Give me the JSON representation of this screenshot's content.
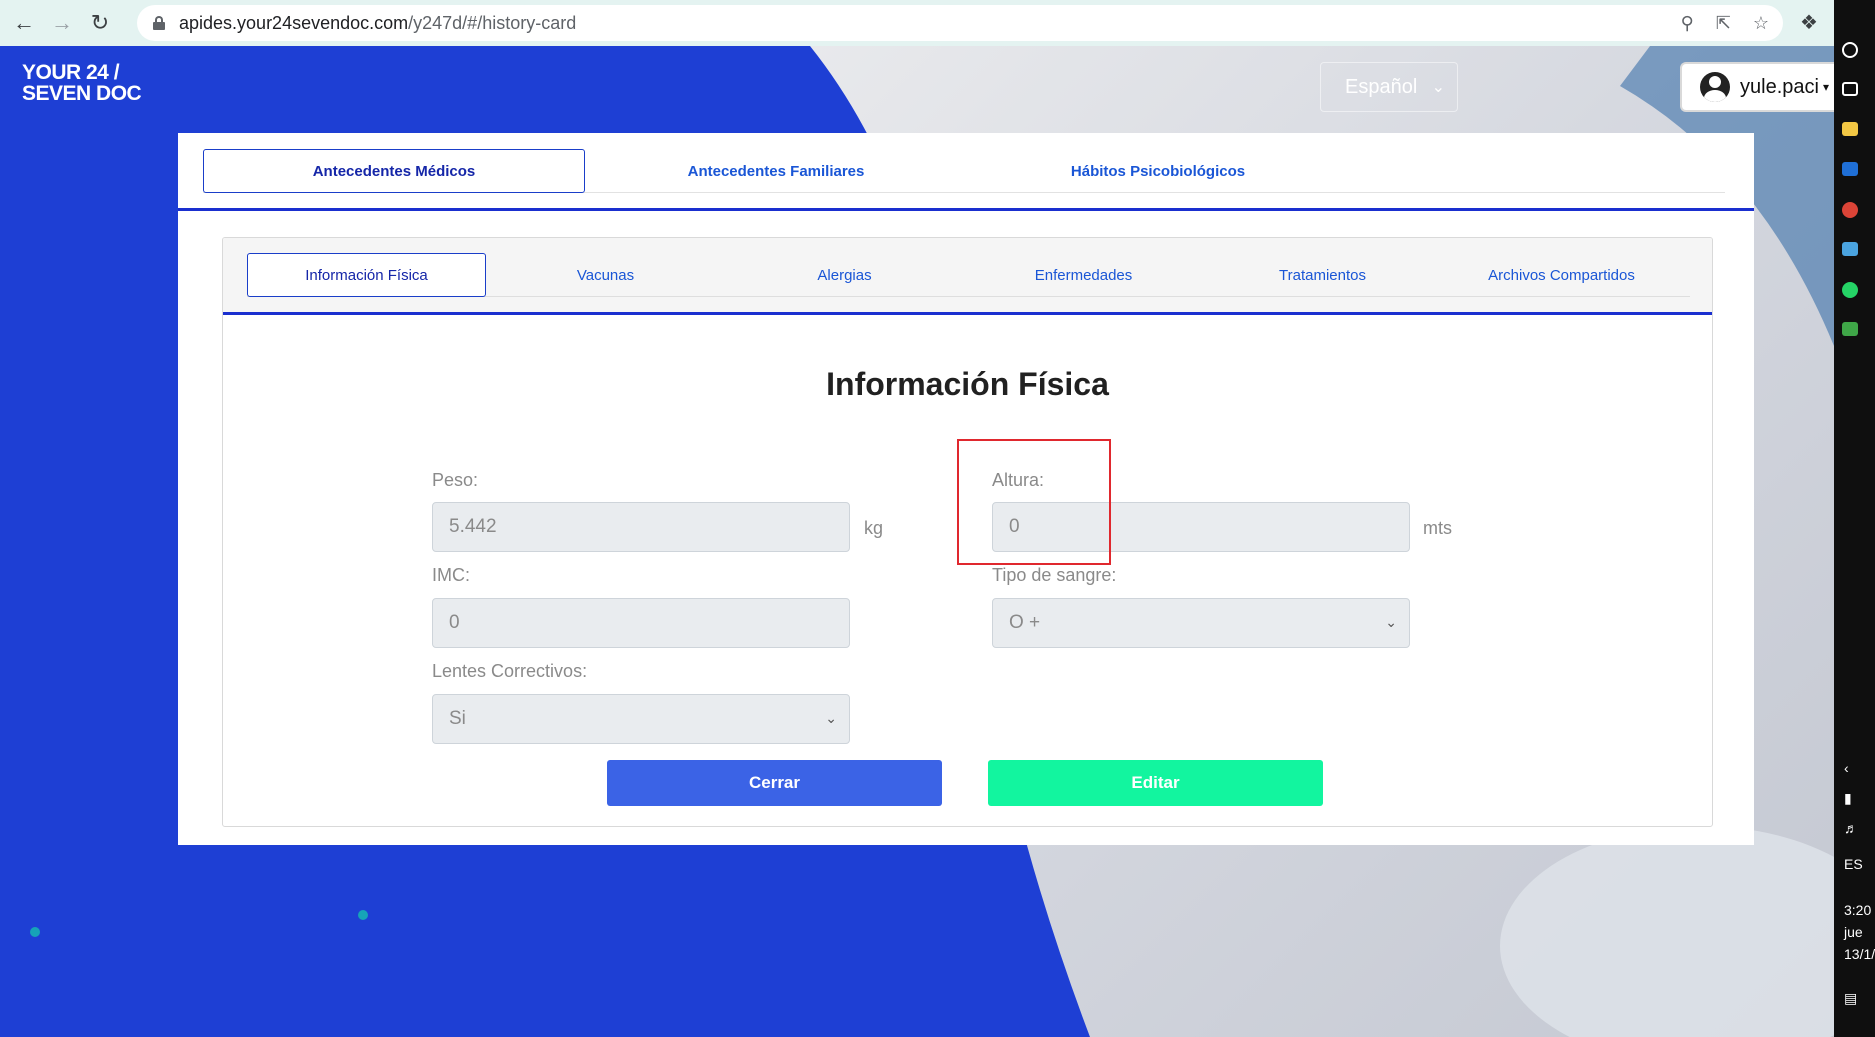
{
  "browser": {
    "url_host": "apides.your24sevendoc.com",
    "url_path": "/y247d/#/history-card"
  },
  "header": {
    "logo_line1": "YOUR 24 /",
    "logo_line2": "SEVEN DOC",
    "language": "Español",
    "user_name": "yule.paci"
  },
  "top_tabs": [
    {
      "label": "Antecedentes Médicos",
      "active": true
    },
    {
      "label": "Antecedentes Familiares",
      "active": false
    },
    {
      "label": "Hábitos Psicobiológicos",
      "active": false
    }
  ],
  "sub_tabs": [
    {
      "label": "Información Física",
      "active": true
    },
    {
      "label": "Vacunas",
      "active": false
    },
    {
      "label": "Alergias",
      "active": false
    },
    {
      "label": "Enfermedades",
      "active": false
    },
    {
      "label": "Tratamientos",
      "active": false
    },
    {
      "label": "Archivos Compartidos",
      "active": false
    }
  ],
  "form": {
    "title": "Información Física",
    "peso_label": "Peso:",
    "peso_value": "5.442",
    "peso_unit": "kg",
    "altura_label": "Altura:",
    "altura_value": "0",
    "altura_unit": "mts",
    "imc_label": "IMC:",
    "imc_value": "0",
    "sangre_label": "Tipo de sangre:",
    "sangre_value": "O +",
    "lentes_label": "Lentes Correctivos:",
    "lentes_value": "Si"
  },
  "buttons": {
    "close": "Cerrar",
    "edit": "Editar"
  },
  "taskbar": {
    "lang": "ES",
    "time": "3:20",
    "day": "jue",
    "date": "13/1/"
  },
  "colors": {
    "brand_blue": "#1e3fd4",
    "tab_text": "#1a56d6",
    "close_button": "#3b63e6",
    "edit_button": "#12f59f",
    "highlight": "#e0282e"
  }
}
